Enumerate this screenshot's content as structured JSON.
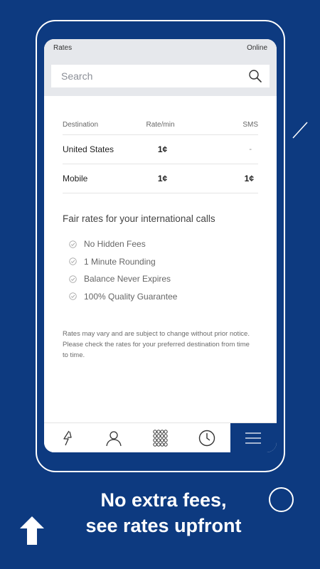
{
  "status_bar": {
    "title": "Rates",
    "connection": "Online"
  },
  "search": {
    "placeholder": "Search"
  },
  "rates_table": {
    "headers": [
      "Destination",
      "Rate/min",
      "SMS"
    ],
    "rows": [
      {
        "destination": "United States",
        "rate": "1¢",
        "sms": "-"
      },
      {
        "destination": "Mobile",
        "rate": "1¢",
        "sms": "1¢"
      }
    ]
  },
  "fair_rates": {
    "title": "Fair rates for your international calls",
    "features": [
      "No Hidden Fees",
      "1 Minute Rounding",
      "Balance Never Expires",
      "100% Quality Guarantee"
    ]
  },
  "disclaimer": "Rates may vary and are subject to change without prior notice. Please check the rates for your preferred destination from time to time.",
  "bottom_nav": {
    "items": [
      {
        "icon": "lightning-icon",
        "active": false
      },
      {
        "icon": "person-icon",
        "active": false
      },
      {
        "icon": "dialpad-icon",
        "active": false
      },
      {
        "icon": "clock-icon",
        "active": false
      },
      {
        "icon": "menu-icon",
        "active": true
      }
    ]
  },
  "promo": {
    "line1": "No extra fees,",
    "line2": "see rates upfront"
  },
  "colors": {
    "brand_blue": "#0d3a80",
    "accent_white": "#ffffff"
  }
}
